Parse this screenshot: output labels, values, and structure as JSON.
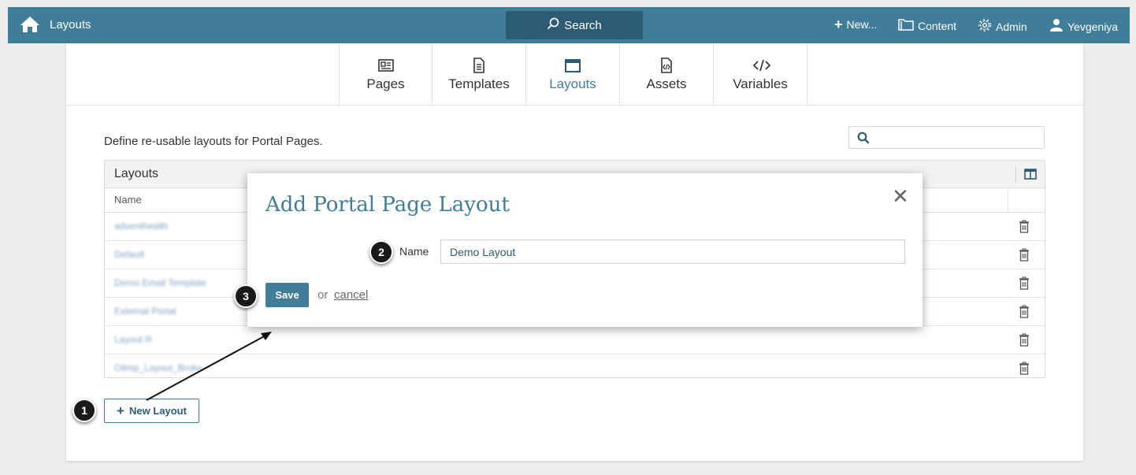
{
  "topbar": {
    "app_name": "Layouts",
    "search_label": "Search",
    "new_label": "New...",
    "content_label": "Content",
    "admin_label": "Admin",
    "user_label": "Yevgeniya"
  },
  "tabs": [
    {
      "label": "Pages",
      "icon": "pages-icon"
    },
    {
      "label": "Templates",
      "icon": "templates-icon"
    },
    {
      "label": "Layouts",
      "icon": "layouts-icon",
      "active": true
    },
    {
      "label": "Assets",
      "icon": "assets-icon"
    },
    {
      "label": "Variables",
      "icon": "variables-icon"
    }
  ],
  "description": "Define re-usable layouts for Portal Pages.",
  "grid": {
    "title": "Layouts",
    "column_name": "Name",
    "rows": [
      "adventhealth",
      "Default",
      "Demo Email Template",
      "External Portal",
      "Layout R",
      "Olimp_Layout_Broke"
    ]
  },
  "new_layout_label": "New Layout",
  "modal": {
    "title": "Add Portal Page Layout",
    "name_label": "Name",
    "name_value": "Demo Layout",
    "save_label": "Save",
    "or_text": "or",
    "cancel_label": "cancel"
  },
  "callouts": [
    "1",
    "2",
    "3"
  ],
  "colors": {
    "topbar": "#3f7d99",
    "search": "#2b5c73",
    "accent": "#3f7d99"
  }
}
